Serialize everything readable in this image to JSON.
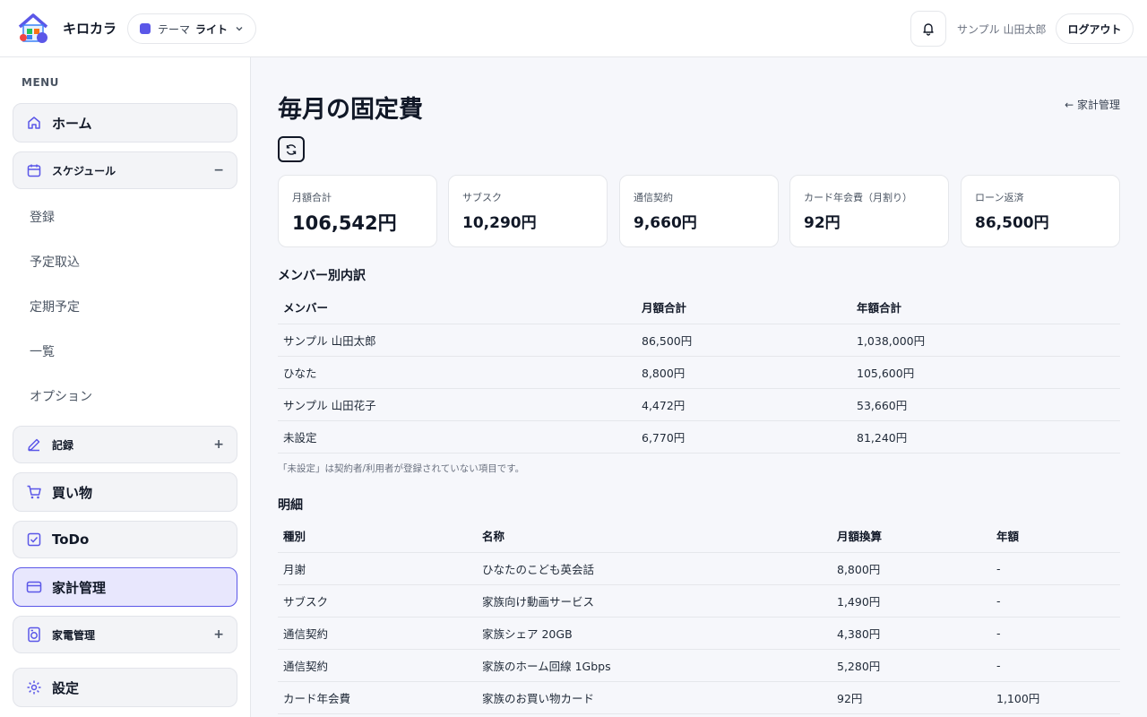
{
  "header": {
    "brand": "キロカラ",
    "theme_label": "テーマ",
    "theme_value": "ライト",
    "user_name": "サンプル 山田太郎",
    "logout_label": "ログアウト",
    "theme_color": "#5b57e8"
  },
  "sidebar": {
    "menu_label": "MENU",
    "home": "ホーム",
    "schedule": {
      "label": "スケジュール",
      "toggle": "−",
      "children": [
        "登録",
        "予定取込",
        "定期予定",
        "一覧",
        "オプション"
      ]
    },
    "records": {
      "label": "記録",
      "toggle": "+"
    },
    "shopping": "買い物",
    "todo": "ToDo",
    "household": "家計管理",
    "appliances": {
      "label": "家電管理",
      "toggle": "+"
    },
    "settings": "設定"
  },
  "main": {
    "title": "毎月の固定費",
    "back_link": "← 家計管理",
    "stats": [
      {
        "label": "月額合計",
        "value": "106,542円"
      },
      {
        "label": "サブスク",
        "value": "10,290円"
      },
      {
        "label": "通信契約",
        "value": "9,660円"
      },
      {
        "label": "カード年会費（月割り）",
        "value": "92円"
      },
      {
        "label": "ローン返済",
        "value": "86,500円"
      }
    ],
    "member_section": {
      "title": "メンバー別内訳",
      "headers": [
        "メンバー",
        "月額合計",
        "年額合計"
      ],
      "rows": [
        [
          "サンプル 山田太郎",
          "86,500円",
          "1,038,000円"
        ],
        [
          "ひなた",
          "8,800円",
          "105,600円"
        ],
        [
          "サンプル 山田花子",
          "4,472円",
          "53,660円"
        ],
        [
          "未設定",
          "6,770円",
          "81,240円"
        ]
      ],
      "note": "「未設定」は契約者/利用者が登録されていない項目です。"
    },
    "detail_section": {
      "title": "明細",
      "headers": [
        "種別",
        "名称",
        "月額換算",
        "年額"
      ],
      "rows": [
        [
          "月謝",
          "ひなたのこども英会話",
          "8,800円",
          "-"
        ],
        [
          "サブスク",
          "家族向け動画サービス",
          "1,490円",
          "-"
        ],
        [
          "通信契約",
          "家族シェア 20GB",
          "4,380円",
          "-"
        ],
        [
          "通信契約",
          "家族のホーム回線 1Gbps",
          "5,280円",
          "-"
        ],
        [
          "カード年会費",
          "家族のお買い物カード",
          "92円",
          "1,100円"
        ]
      ]
    }
  }
}
